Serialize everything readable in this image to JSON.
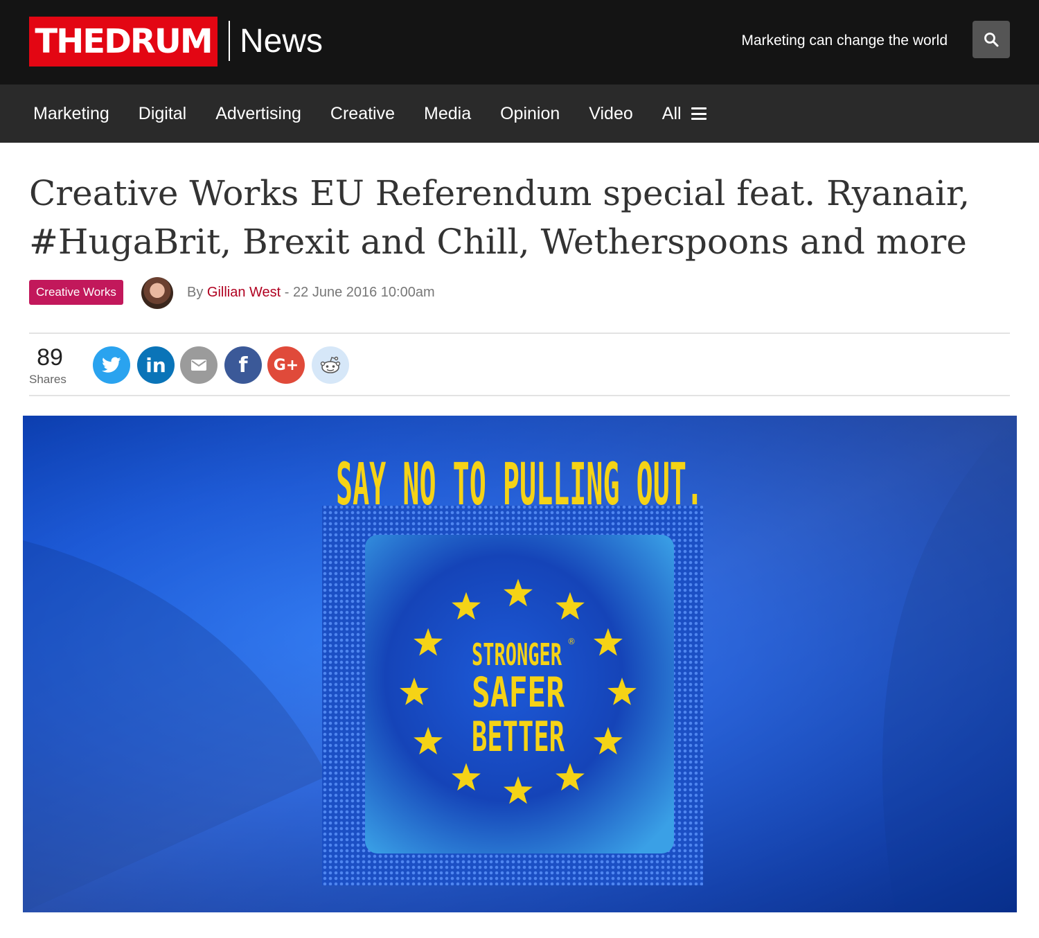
{
  "header": {
    "logo_text": "THEDRUM",
    "section": "News",
    "tagline": "Marketing can change the world",
    "search_icon": "search-icon",
    "brand_color": "#e30613"
  },
  "nav": {
    "items": [
      {
        "label": "Marketing"
      },
      {
        "label": "Digital"
      },
      {
        "label": "Advertising"
      },
      {
        "label": "Creative"
      },
      {
        "label": "Media"
      },
      {
        "label": "Opinion"
      },
      {
        "label": "Video"
      }
    ],
    "all_label": "All"
  },
  "article": {
    "title": "Creative Works EU Referendum special feat. Ryanair, #HugaBrit, Brexit and Chill, Wetherspoons and more",
    "category": "Creative Works",
    "category_color": "#c2185b",
    "by_prefix": "By",
    "author": "Gillian West",
    "separator": "-",
    "date": "22 June 2016 10:00am"
  },
  "shares": {
    "count": "89",
    "label": "Shares",
    "buttons": [
      {
        "icon": "twitter-icon",
        "glyph": "🐦",
        "color": "#2aa3ef"
      },
      {
        "icon": "linkedin-icon",
        "glyph": "in",
        "color": "#0a74b8"
      },
      {
        "icon": "email-icon",
        "glyph": "✉",
        "color": "#999999"
      },
      {
        "icon": "facebook-icon",
        "glyph": "f",
        "color": "#3b5998"
      },
      {
        "icon": "google-plus-icon",
        "glyph": "G+",
        "color": "#e04a3a"
      },
      {
        "icon": "reddit-icon",
        "glyph": "👽",
        "color": "#cfe3f6"
      }
    ]
  },
  "hero": {
    "headline": "SAY NO TO PULLING OUT.",
    "line1": "STRONGER",
    "line2": "SAFER",
    "line3": "BETTER",
    "registered": "®",
    "star_color": "#f5d316"
  }
}
